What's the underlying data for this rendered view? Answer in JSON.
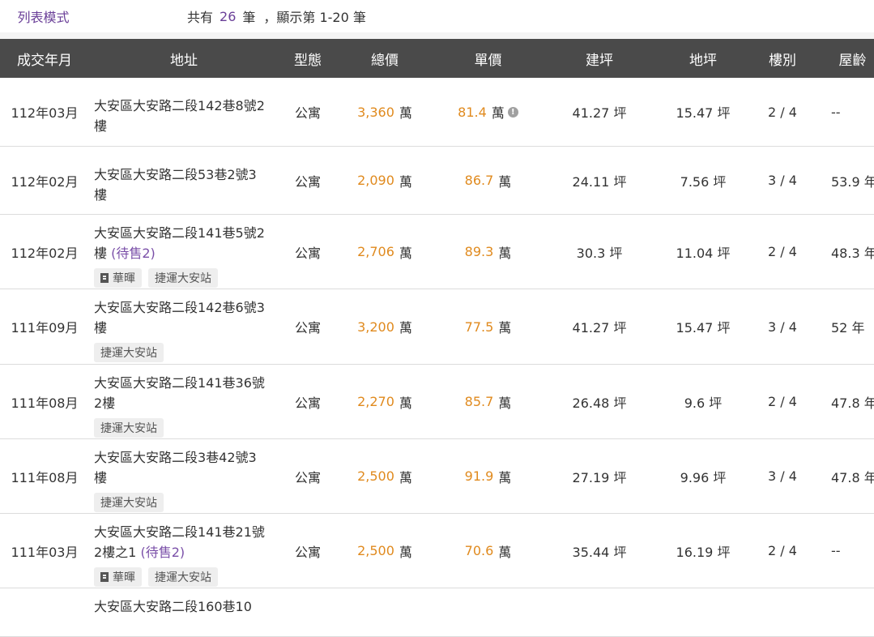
{
  "header": {
    "mode_tab": "列表模式",
    "summary_prefix": "共有",
    "total_count": "26",
    "summary_unit": "筆",
    "summary_range": "，顯示第 1-20 筆"
  },
  "table": {
    "columns": [
      "成交年月",
      "地址",
      "型態",
      "總價",
      "單價",
      "建坪",
      "地坪",
      "樓別",
      "屋齡"
    ],
    "rows": [
      {
        "date": "112年03月",
        "addr": "大安區大安路二段142巷8號2樓",
        "pending": "",
        "tags": [],
        "type": "公寓",
        "total": "3,360",
        "total_unit": "萬",
        "unit": "81.4",
        "unit_u": "萬",
        "has_info": true,
        "build": "41.27 坪",
        "land": "15.47 坪",
        "floor": "2 / 4",
        "age": "--"
      },
      {
        "date": "112年02月",
        "addr": "大安區大安路二段53巷2號3樓",
        "pending": "",
        "tags": [],
        "type": "公寓",
        "total": "2,090",
        "total_unit": "萬",
        "unit": "86.7",
        "unit_u": "萬",
        "has_info": false,
        "build": "24.11 坪",
        "land": "7.56 坪",
        "floor": "3 / 4",
        "age": "53.9 年"
      },
      {
        "date": "112年02月",
        "addr": "大安區大安路二段141巷5號2樓",
        "pending": "(待售2)",
        "tags": [
          "華暉",
          "捷運大安站"
        ],
        "type": "公寓",
        "total": "2,706",
        "total_unit": "萬",
        "unit": "89.3",
        "unit_u": "萬",
        "has_info": false,
        "build": "30.3 坪",
        "land": "11.04 坪",
        "floor": "2 / 4",
        "age": "48.3 年"
      },
      {
        "date": "111年09月",
        "addr": "大安區大安路二段142巷6號3樓",
        "pending": "",
        "tags": [
          "捷運大安站"
        ],
        "type": "公寓",
        "total": "3,200",
        "total_unit": "萬",
        "unit": "77.5",
        "unit_u": "萬",
        "has_info": false,
        "build": "41.27 坪",
        "land": "15.47 坪",
        "floor": "3 / 4",
        "age": "52 年"
      },
      {
        "date": "111年08月",
        "addr": "大安區大安路二段141巷36號2樓",
        "pending": "",
        "tags": [
          "捷運大安站"
        ],
        "type": "公寓",
        "total": "2,270",
        "total_unit": "萬",
        "unit": "85.7",
        "unit_u": "萬",
        "has_info": false,
        "build": "26.48 坪",
        "land": "9.6 坪",
        "floor": "2 / 4",
        "age": "47.8 年"
      },
      {
        "date": "111年08月",
        "addr": "大安區大安路二段3巷42號3樓",
        "pending": "",
        "tags": [
          "捷運大安站"
        ],
        "type": "公寓",
        "total": "2,500",
        "total_unit": "萬",
        "unit": "91.9",
        "unit_u": "萬",
        "has_info": false,
        "build": "27.19 坪",
        "land": "9.96 坪",
        "floor": "3 / 4",
        "age": "47.8 年"
      },
      {
        "date": "111年03月",
        "addr": "大安區大安路二段141巷21號2樓之1",
        "pending": "(待售2)",
        "tags": [
          "華暉",
          "捷運大安站"
        ],
        "type": "公寓",
        "total": "2,500",
        "total_unit": "萬",
        "unit": "70.6",
        "unit_u": "萬",
        "has_info": false,
        "build": "35.44 坪",
        "land": "16.19 坪",
        "floor": "2 / 4",
        "age": "--"
      },
      {
        "date": "",
        "addr": "大安區大安路二段160巷10",
        "pending": "",
        "tags": [],
        "type": "",
        "total": "",
        "total_unit": "",
        "unit": "",
        "unit_u": "",
        "has_info": false,
        "build": "",
        "land": "",
        "floor": "",
        "age": ""
      }
    ]
  },
  "colors": {
    "accent": "#6a3f98",
    "price": "#e08a1e",
    "header_bg": "#4a4a4a"
  }
}
